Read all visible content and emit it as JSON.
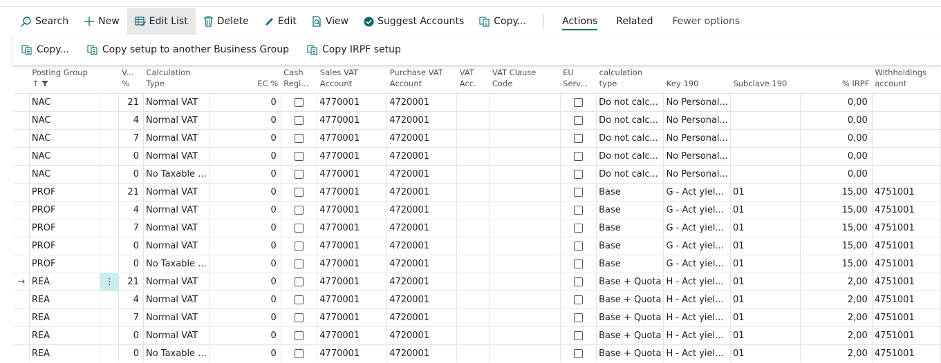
{
  "toolbar": {
    "search": "Search",
    "new": "New",
    "edit_list": "Edit List",
    "delete": "Delete",
    "edit": "Edit",
    "view": "View",
    "suggest_accounts": "Suggest Accounts",
    "copy": "Copy...",
    "actions": "Actions",
    "related": "Related",
    "fewer_options": "Fewer options"
  },
  "submenu": {
    "copy": "Copy...",
    "copy_setup": "Copy setup to another Business Group",
    "copy_irpf": "Copy IRPF setup"
  },
  "columns": {
    "posting_group_1": "Posting Group",
    "posting_group_2": "↑",
    "vat_pct_1": "V...",
    "vat_pct_2": "%",
    "calc_type_1": "Calculation",
    "calc_type_2": "Type",
    "ec_pct": "EC %",
    "cash_reg_1": "Cash",
    "cash_reg_2": "Regi...",
    "sales_vat_1": "Sales VAT",
    "sales_vat_2": "Account",
    "purchase_vat_1": "Purchase VAT",
    "purchase_vat_2": "Account",
    "vat_acc_1": "VAT",
    "vat_acc_2": "Acc.",
    "vat_clause_1": "VAT Clause",
    "vat_clause_2": "Code",
    "eu_serv_1": "EU",
    "eu_serv_2": "Serv...",
    "calc_type_irpf_1": "calculation",
    "calc_type_irpf_2": "type",
    "key190": "Key 190",
    "subclave190": "Subclave 190",
    "irpf_pct": "% IRPF",
    "withholdings_1": "Withholdings",
    "withholdings_2": "account"
  },
  "rows": [
    {
      "pg": "NAC",
      "vat": "21",
      "calc": "Normal VAT",
      "ec": "0",
      "sales": "4770001",
      "purch": "4720001",
      "ctype": "Do not calc...",
      "key": "No Personal...",
      "sub": "",
      "irpf": "0,00",
      "wh": ""
    },
    {
      "pg": "NAC",
      "vat": "4",
      "calc": "Normal VAT",
      "ec": "0",
      "sales": "4770001",
      "purch": "4720001",
      "ctype": "Do not calc...",
      "key": "No Personal...",
      "sub": "",
      "irpf": "0,00",
      "wh": ""
    },
    {
      "pg": "NAC",
      "vat": "7",
      "calc": "Normal VAT",
      "ec": "0",
      "sales": "4770001",
      "purch": "4720001",
      "ctype": "Do not calc...",
      "key": "No Personal...",
      "sub": "",
      "irpf": "0,00",
      "wh": ""
    },
    {
      "pg": "NAC",
      "vat": "0",
      "calc": "Normal VAT",
      "ec": "0",
      "sales": "4770001",
      "purch": "4720001",
      "ctype": "Do not calc...",
      "key": "No Personal...",
      "sub": "",
      "irpf": "0,00",
      "wh": ""
    },
    {
      "pg": "NAC",
      "vat": "0",
      "calc": "No Taxable ...",
      "ec": "0",
      "sales": "4770001",
      "purch": "4720001",
      "ctype": "Do not calc...",
      "key": "No Personal...",
      "sub": "",
      "irpf": "0,00",
      "wh": ""
    },
    {
      "pg": "PROF",
      "vat": "21",
      "calc": "Normal VAT",
      "ec": "0",
      "sales": "4770001",
      "purch": "4720001",
      "ctype": "Base",
      "key": "G - Act yiel...",
      "sub": "01",
      "irpf": "15,00",
      "wh": "4751001"
    },
    {
      "pg": "PROF",
      "vat": "4",
      "calc": "Normal VAT",
      "ec": "0",
      "sales": "4770001",
      "purch": "4720001",
      "ctype": "Base",
      "key": "G - Act yiel...",
      "sub": "01",
      "irpf": "15,00",
      "wh": "4751001"
    },
    {
      "pg": "PROF",
      "vat": "7",
      "calc": "Normal VAT",
      "ec": "0",
      "sales": "4770001",
      "purch": "4720001",
      "ctype": "Base",
      "key": "G - Act yiel...",
      "sub": "01",
      "irpf": "15,00",
      "wh": "4751001"
    },
    {
      "pg": "PROF",
      "vat": "0",
      "calc": "Normal VAT",
      "ec": "0",
      "sales": "4770001",
      "purch": "4720001",
      "ctype": "Base",
      "key": "G - Act yiel...",
      "sub": "01",
      "irpf": "15,00",
      "wh": "4751001"
    },
    {
      "pg": "PROF",
      "vat": "0",
      "calc": "No Taxable ...",
      "ec": "0",
      "sales": "4770001",
      "purch": "4720001",
      "ctype": "Base",
      "key": "G - Act yiel...",
      "sub": "01",
      "irpf": "15,00",
      "wh": "4751001"
    },
    {
      "pg": "REA",
      "vat": "21",
      "calc": "Normal VAT",
      "ec": "0",
      "sales": "4770001",
      "purch": "4720001",
      "ctype": "Base + Quota",
      "key": "H - Act yiel...",
      "sub": "01",
      "irpf": "2,00",
      "wh": "4751001",
      "selected": true,
      "indicator": "→",
      "menu": "⋮"
    },
    {
      "pg": "REA",
      "vat": "4",
      "calc": "Normal VAT",
      "ec": "0",
      "sales": "4770001",
      "purch": "4720001",
      "ctype": "Base + Quota",
      "key": "H - Act yiel...",
      "sub": "01",
      "irpf": "2,00",
      "wh": "4751001"
    },
    {
      "pg": "REA",
      "vat": "7",
      "calc": "Normal VAT",
      "ec": "0",
      "sales": "4770001",
      "purch": "4720001",
      "ctype": "Base + Quota",
      "key": "H - Act yiel...",
      "sub": "01",
      "irpf": "2,00",
      "wh": "4751001"
    },
    {
      "pg": "REA",
      "vat": "0",
      "calc": "Normal VAT",
      "ec": "0",
      "sales": "4770001",
      "purch": "4720001",
      "ctype": "Base + Quota",
      "key": "H - Act yiel...",
      "sub": "01",
      "irpf": "2,00",
      "wh": "4751001"
    },
    {
      "pg": "REA",
      "vat": "0",
      "calc": "No Taxable ...",
      "ec": "0",
      "sales": "4770001",
      "purch": "4720001",
      "ctype": "Base + Quota",
      "key": "H - Act yiel...",
      "sub": "01",
      "irpf": "2,00",
      "wh": "4751001"
    }
  ]
}
